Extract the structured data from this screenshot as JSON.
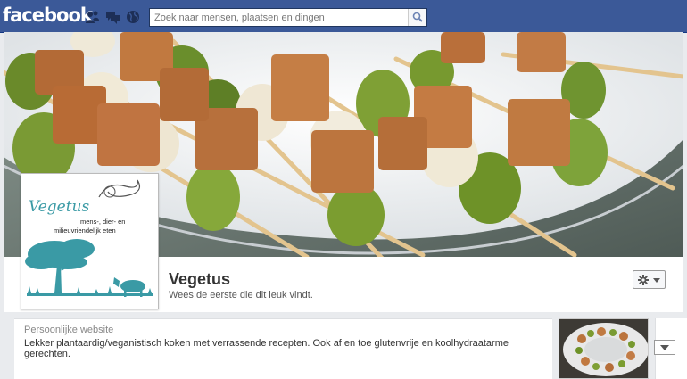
{
  "topbar": {
    "logo": "facebook",
    "jewels": [
      "friend-requests-icon",
      "messages-icon",
      "notifications-globe-icon"
    ]
  },
  "search": {
    "placeholder": "Zoek naar mensen, plaatsen en dingen",
    "value": ""
  },
  "page": {
    "name": "Vegetus",
    "likes_text": "Wees de eerste die dit leuk vindt."
  },
  "profile_logo": {
    "brand": "Vegetus",
    "tagline_line1": "mens-, dier- en",
    "tagline_line2": "milieuvriendelijk eten"
  },
  "info": {
    "label": "Persoonlijke website",
    "text": "Lekker plantaardig/veganistisch koken met verrassende recepten. Ook af en toe glutenvrije en koolhydraatarme gerechten."
  },
  "colors": {
    "brand_blue": "#3b5998",
    "logo_teal": "#3a9aa5"
  }
}
